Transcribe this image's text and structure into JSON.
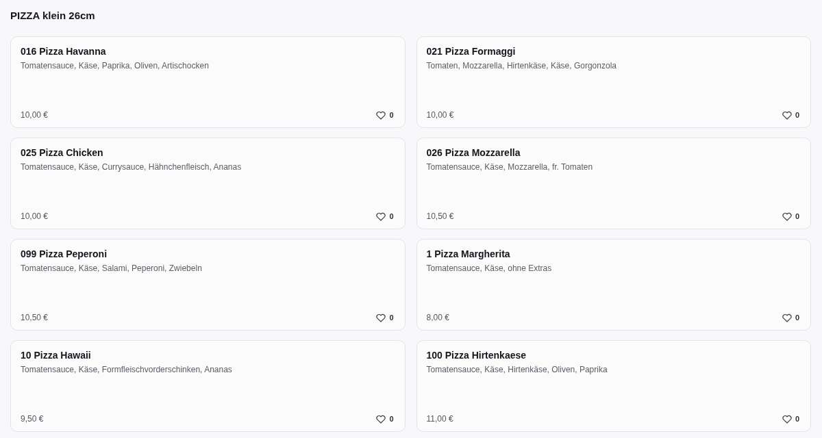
{
  "category": {
    "title": "PIZZA klein 26cm"
  },
  "items": [
    {
      "name": "016 Pizza Havanna",
      "description": "Tomatensauce, Käse, Paprika, Oliven, Artischocken",
      "price": "10,00 €",
      "likes": "0"
    },
    {
      "name": "021 Pizza Formaggi",
      "description": "Tomaten, Mozzarella, Hirtenkäse, Käse, Gorgonzola",
      "price": "10,00 €",
      "likes": "0"
    },
    {
      "name": "025 Pizza Chicken",
      "description": "Tomatensauce, Käse, Currysauce, Hähnchenfleisch, Ananas",
      "price": "10,00 €",
      "likes": "0"
    },
    {
      "name": "026 Pizza Mozzarella",
      "description": "Tomatensauce, Käse, Mozzarella, fr. Tomaten",
      "price": "10,50 €",
      "likes": "0"
    },
    {
      "name": "099 Pizza Peperoni",
      "description": "Tomatensauce, Käse, Salami, Peperoni, Zwiebeln",
      "price": "10,50 €",
      "likes": "0"
    },
    {
      "name": "1 Pizza Margherita",
      "description": "Tomatensauce, Käse, ohne Extras",
      "price": "8,00 €",
      "likes": "0"
    },
    {
      "name": "10 Pizza Hawaii",
      "description": "Tomatensauce, Käse, Formfleischvorderschinken, Ananas",
      "price": "9,50 €",
      "likes": "0"
    },
    {
      "name": "100 Pizza Hirtenkaese",
      "description": "Tomatensauce, Käse, Hirtenkäse, Oliven, Paprika",
      "price": "11,00 €",
      "likes": "0"
    }
  ]
}
